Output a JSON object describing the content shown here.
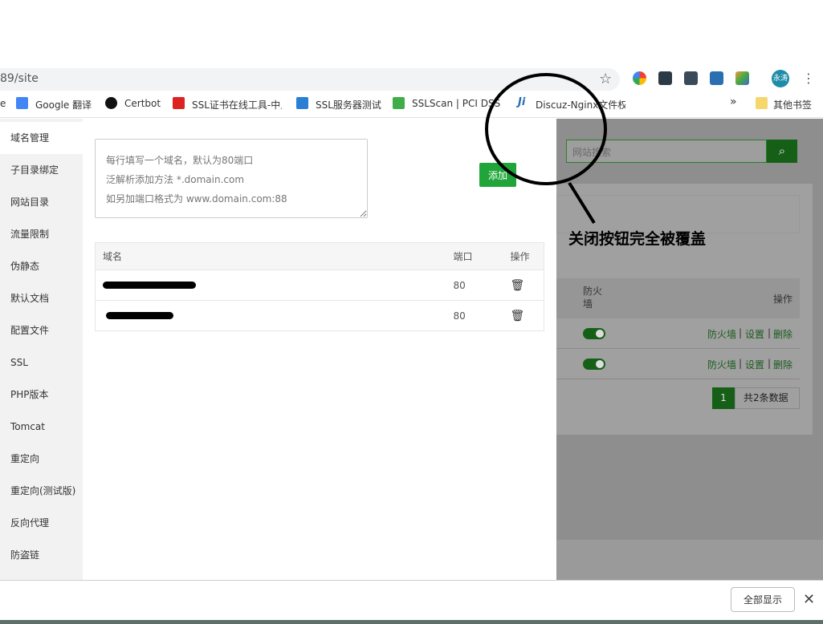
{
  "browser": {
    "address": "89/site",
    "bookmarks": [
      {
        "label": "e"
      },
      {
        "label": "Google 翻译"
      },
      {
        "label": "Certbot"
      },
      {
        "label": "SSL证书在线工具-中⼈"
      },
      {
        "label": "SSL服务器测试"
      },
      {
        "label": "SSLScan | PCI DSS"
      },
      {
        "label": "Discuz-Nginx文件权"
      }
    ],
    "more_bookmarks": "»",
    "other_bookmarks": "其他书签",
    "avatar_text": "永涛"
  },
  "modal": {
    "nav_items": [
      {
        "label": "域名管理"
      },
      {
        "label": "子目录绑定"
      },
      {
        "label": "网站目录"
      },
      {
        "label": "流量限制"
      },
      {
        "label": "伪静态"
      },
      {
        "label": "默认文档"
      },
      {
        "label": "配置文件"
      },
      {
        "label": "SSL"
      },
      {
        "label": "PHP版本"
      },
      {
        "label": "Tomcat"
      },
      {
        "label": "重定向"
      },
      {
        "label": "重定向(测试版)"
      },
      {
        "label": "反向代理"
      },
      {
        "label": "防盗链"
      }
    ],
    "textarea_placeholder": "每行填写一个域名，默认为80端口\n泛解析添加方法 *.domain.com\n如另加端口格式为 www.domain.com:88",
    "add_button": "添加",
    "table": {
      "headers": {
        "domain": "域名",
        "port": "端口",
        "action": "操作"
      },
      "rows": [
        {
          "port": "80"
        },
        {
          "port": "80"
        }
      ]
    }
  },
  "background_page": {
    "search_placeholder": "网站搜索",
    "col_firewall": "防火\n墙",
    "col_action": "操作",
    "row_links": {
      "firewall": "防火墙",
      "settings": "设置",
      "delete": "删除",
      "sep": "|"
    },
    "pagination": {
      "current": "1",
      "total": "共2条数据"
    }
  },
  "annotation": "关闭按钮完全被覆盖",
  "download_bar": {
    "show_all": "全部显示",
    "close": "✕"
  },
  "colors": {
    "accent_green": "#20a53a",
    "dim_overlay": "#8e8e8e"
  }
}
